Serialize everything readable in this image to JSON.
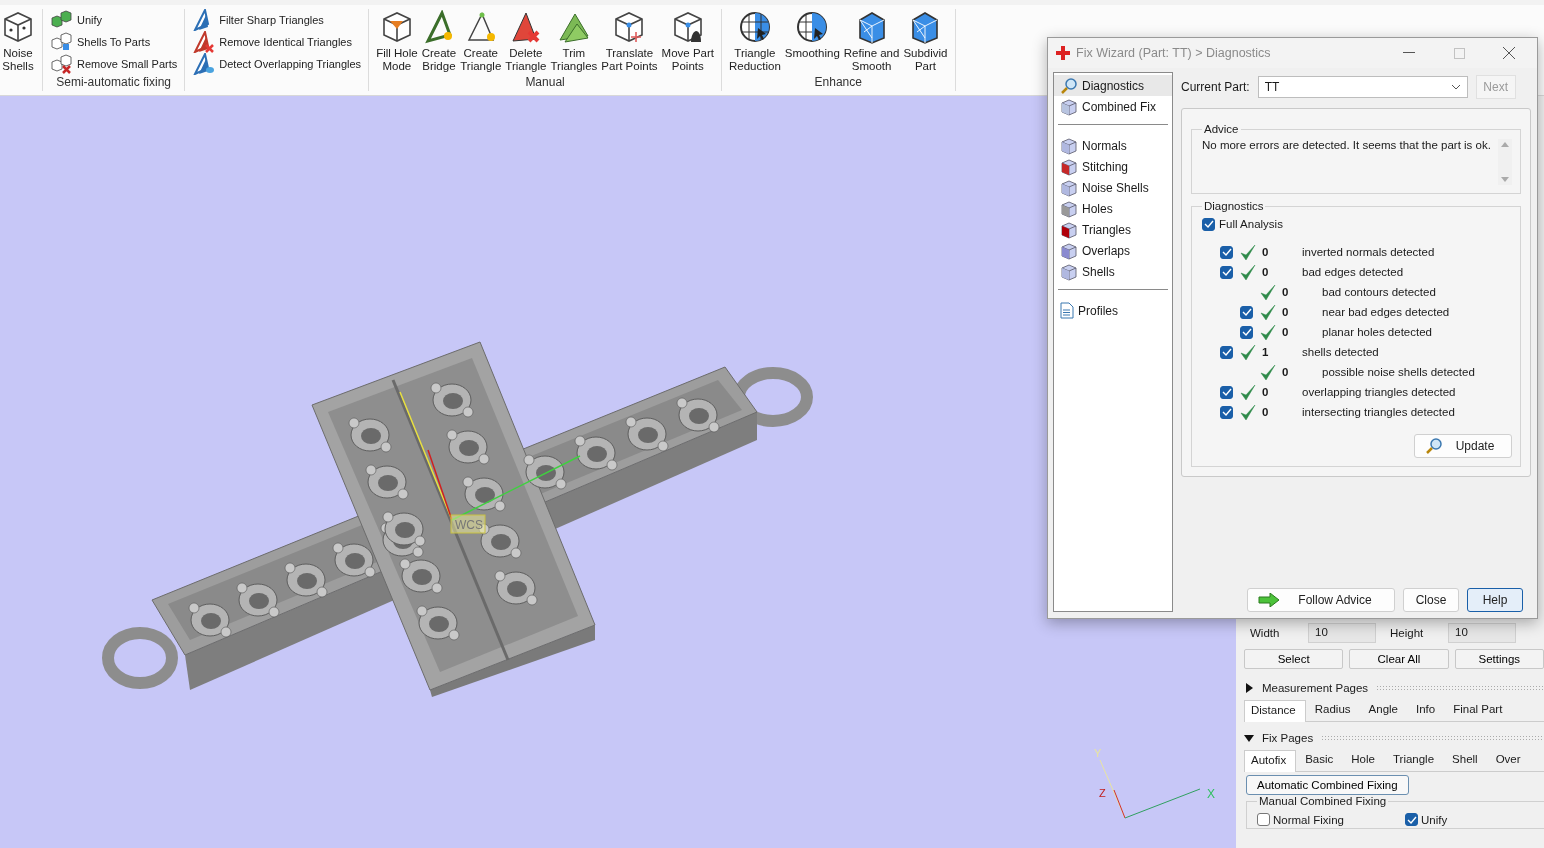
{
  "ribbon": {
    "groups": [
      {
        "kind": "large",
        "items": [
          {
            "label": "Noise\nShells"
          }
        ]
      },
      {
        "kind": "small",
        "label": "Semi-automatic fixing",
        "items": [
          {
            "label": "Unify"
          },
          {
            "label": "Shells To Parts"
          },
          {
            "label": "Remove Small Parts"
          }
        ]
      },
      {
        "kind": "small",
        "items": [
          {
            "label": "Filter Sharp Triangles"
          },
          {
            "label": "Remove Identical Triangles"
          },
          {
            "label": "Detect Overlapping Triangles"
          }
        ]
      },
      {
        "kind": "large",
        "label": "Manual",
        "items": [
          {
            "label": "Fill Hole\nMode"
          },
          {
            "label": "Create\nBridge"
          },
          {
            "label": "Create\nTriangle"
          },
          {
            "label": "Delete\nTriangle"
          },
          {
            "label": "Trim\nTriangles"
          },
          {
            "label": "Translate\nPart Points"
          },
          {
            "label": "Move Part\nPoints"
          }
        ]
      },
      {
        "kind": "large",
        "label": "Enhance",
        "items": [
          {
            "label": "Triangle\nReduction"
          },
          {
            "label": "Smoothing"
          },
          {
            "label": "Refine and\nSmooth"
          },
          {
            "label": "Subdivid\nPart"
          }
        ]
      }
    ]
  },
  "viewport": {
    "gizmo_label": "WCS",
    "triad_labels": [
      "Y",
      "Z",
      "X"
    ]
  },
  "dialog": {
    "title": "Fix Wizard (Part: TT) > Diagnostics",
    "maximize_disabled": true,
    "nav": [
      [
        {
          "label": "Diagnostics",
          "selected": true
        },
        {
          "label": "Combined Fix",
          "selected": false
        }
      ],
      [
        {
          "label": "Normals",
          "selected": false
        },
        {
          "label": "Stitching",
          "selected": false
        },
        {
          "label": "Noise Shells",
          "selected": false
        },
        {
          "label": "Holes",
          "selected": false
        },
        {
          "label": "Triangles",
          "selected": false
        },
        {
          "label": "Overlaps",
          "selected": false
        },
        {
          "label": "Shells",
          "selected": false
        }
      ],
      [
        {
          "label": "Profiles",
          "selected": false
        }
      ]
    ],
    "current_part": {
      "label": "Current Part:",
      "value": "TT"
    },
    "next": {
      "label": "Next",
      "disabled": true
    },
    "advice": {
      "title": "Advice",
      "text": "No more errors are detected. It seems that the part is ok."
    },
    "diagnostics": {
      "title": "Diagnostics",
      "full_analysis": {
        "label": "Full Analysis",
        "checked": true
      },
      "rows": [
        {
          "kind": "check",
          "checked": true,
          "ok": true,
          "count": "0",
          "label": "inverted normals detected"
        },
        {
          "kind": "check",
          "checked": true,
          "ok": true,
          "count": "0",
          "label": "bad edges detected",
          "children": [
            {
              "kind": "info",
              "ok": true,
              "count": "0",
              "label": "bad contours detected"
            },
            {
              "kind": "check",
              "checked": true,
              "ok": true,
              "count": "0",
              "label": "near bad edges detected"
            },
            {
              "kind": "check",
              "checked": true,
              "ok": true,
              "count": "0",
              "label": "planar holes detected"
            }
          ]
        },
        {
          "kind": "check",
          "checked": true,
          "ok": true,
          "count": "1",
          "label": "shells detected",
          "children": [
            {
              "kind": "info",
              "ok": true,
              "count": "0",
              "label": "possible noise shells detected"
            }
          ]
        },
        {
          "kind": "check",
          "checked": true,
          "ok": true,
          "count": "0",
          "label": "overlapping triangles detected"
        },
        {
          "kind": "check",
          "checked": true,
          "ok": true,
          "count": "0",
          "label": "intersecting triangles detected"
        }
      ],
      "update": "Update"
    },
    "buttons": [
      {
        "label": "Follow Advice",
        "kind": "advice",
        "default": false
      },
      {
        "label": "Close",
        "kind": "plain",
        "default": false
      },
      {
        "label": "Help",
        "kind": "plain",
        "default": true
      }
    ]
  },
  "side_panel": {
    "size": [
      {
        "label": "Width",
        "value": "10"
      },
      {
        "label": "Height",
        "value": "10"
      }
    ],
    "actions": [
      "Select",
      "Clear All",
      "Settings"
    ],
    "sections": [
      {
        "title": "Measurement Pages",
        "expanded": false,
        "tabs": [
          {
            "label": "Distance",
            "selected": true
          },
          {
            "label": "Radius",
            "selected": false
          },
          {
            "label": "Angle",
            "selected": false
          },
          {
            "label": "Info",
            "selected": false
          },
          {
            "label": "Final Part",
            "selected": false
          }
        ]
      },
      {
        "title": "Fix Pages",
        "expanded": true,
        "tabs": [
          {
            "label": "Autofix",
            "selected": true
          },
          {
            "label": "Basic",
            "selected": false
          },
          {
            "label": "Hole",
            "selected": false
          },
          {
            "label": "Triangle",
            "selected": false
          },
          {
            "label": "Shell",
            "selected": false
          },
          {
            "label": "Over",
            "selected": false
          }
        ]
      }
    ],
    "auto_button": "Automatic Combined Fixing",
    "manual_group": {
      "title": "Manual Combined Fixing",
      "options": [
        {
          "label": "Normal Fixing",
          "checked": false
        },
        {
          "label": "Unify",
          "checked": true
        }
      ]
    }
  }
}
